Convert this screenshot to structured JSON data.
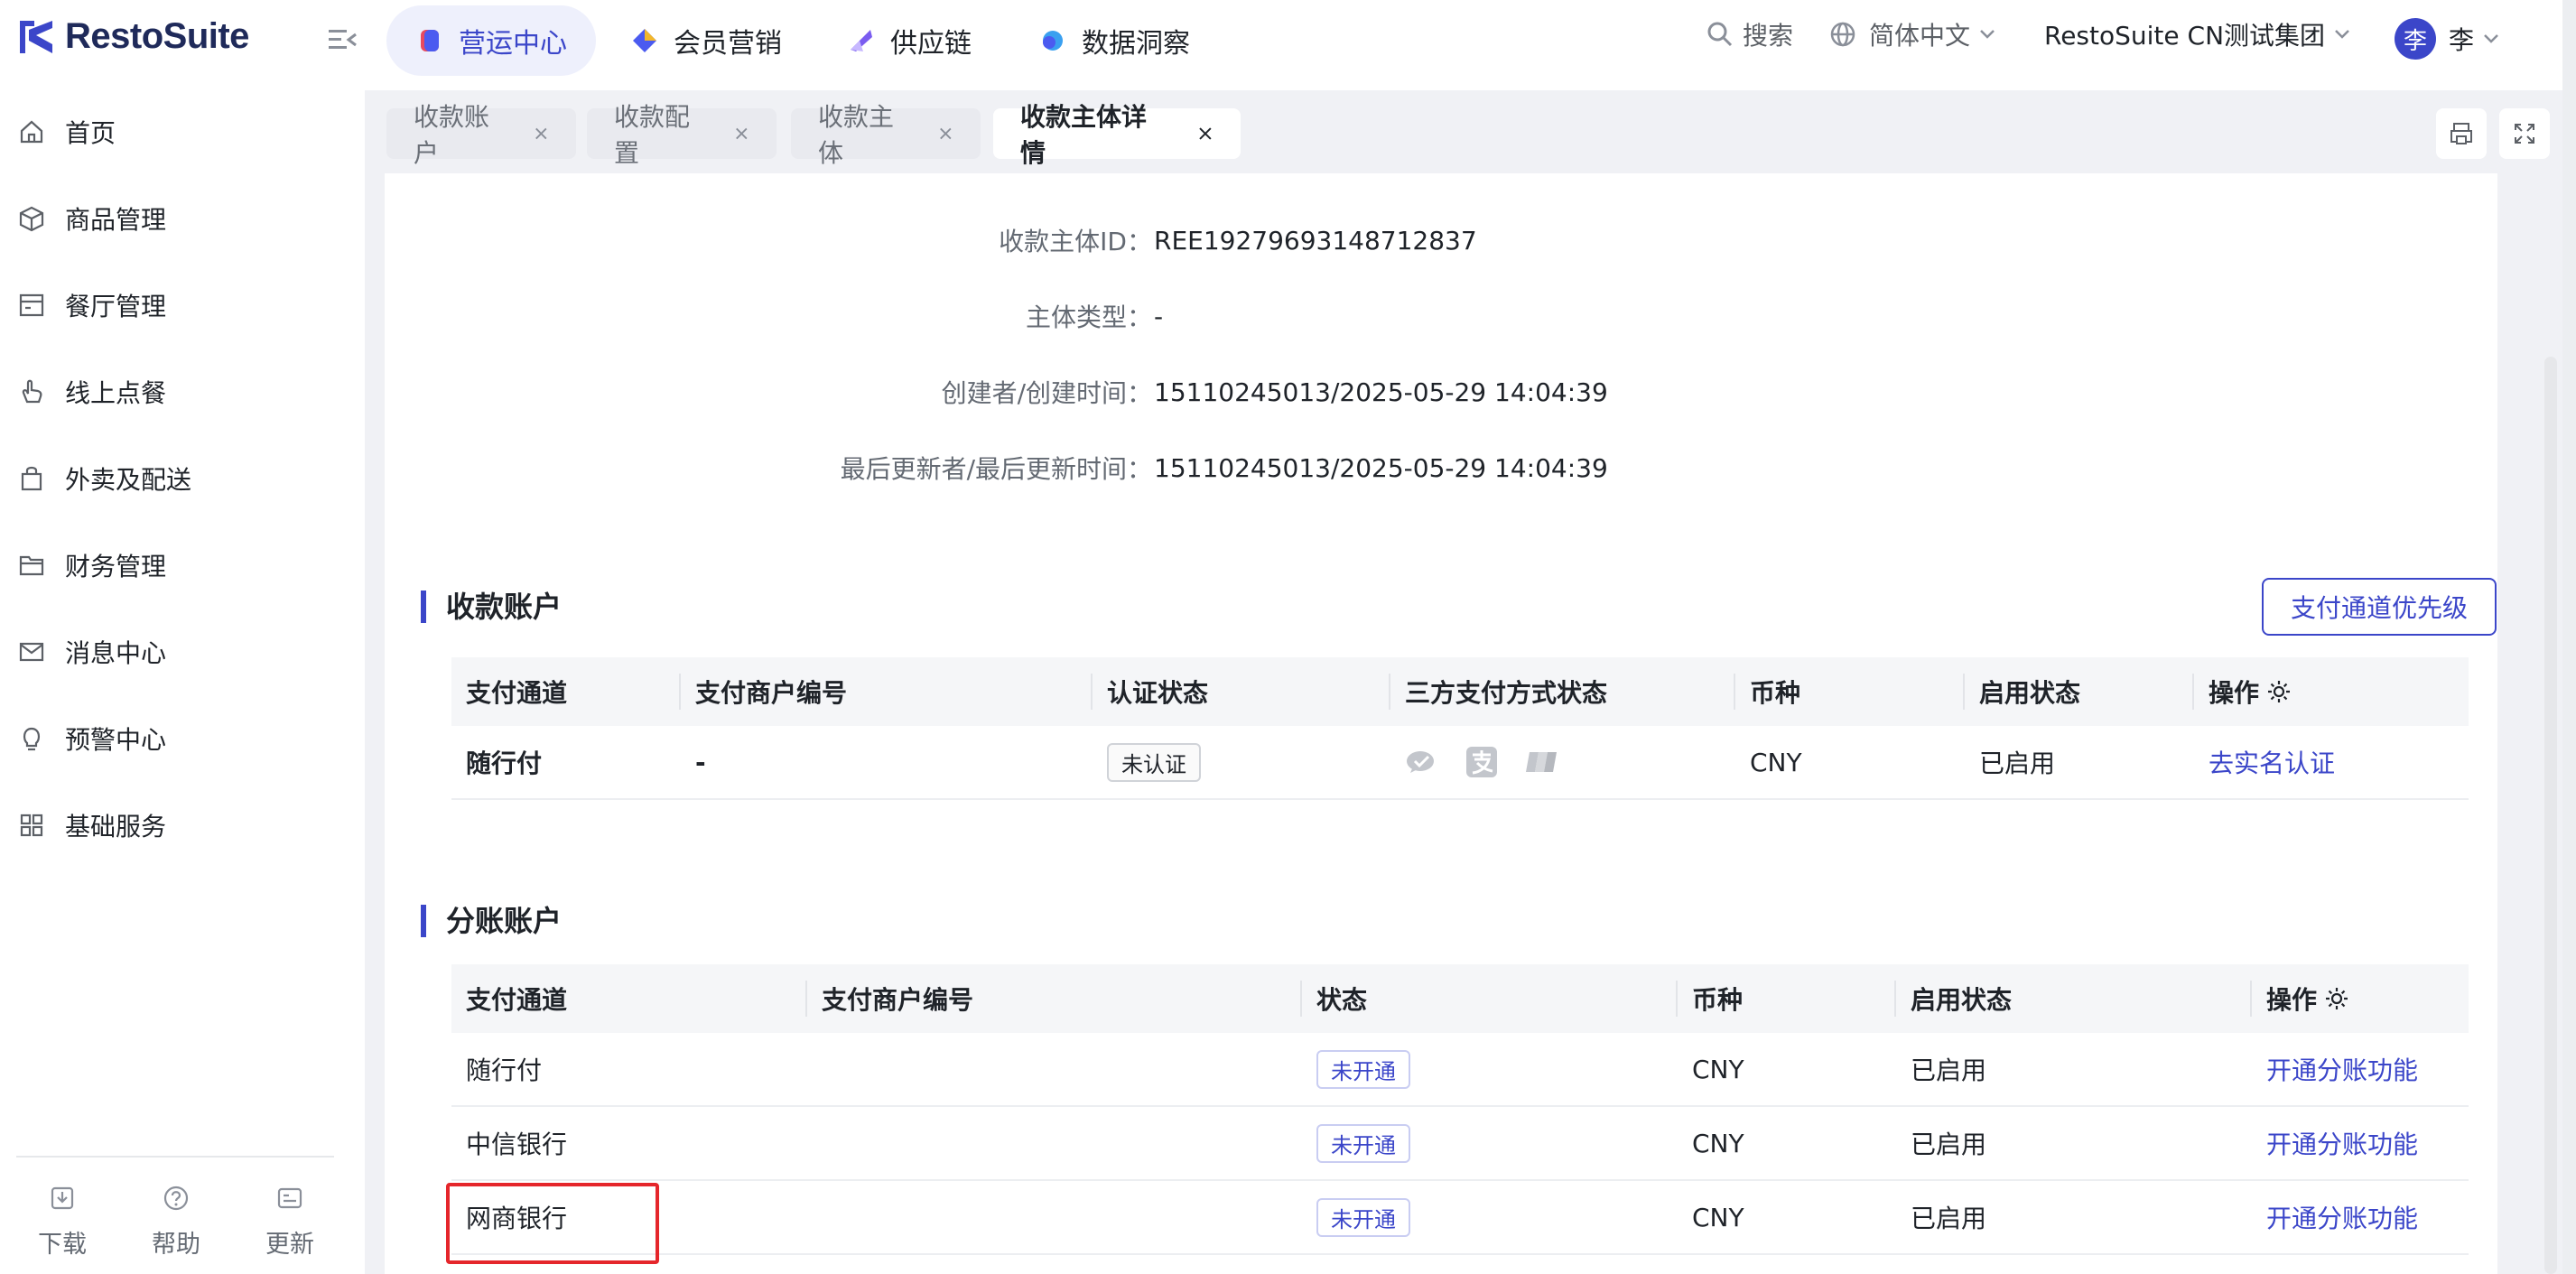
{
  "brand": {
    "name": "RestoSuite",
    "accent": "#3b46c9"
  },
  "topnav": {
    "items": [
      {
        "label": "营运中心",
        "active": true
      },
      {
        "label": "会员营销",
        "active": false
      },
      {
        "label": "供应链",
        "active": false
      },
      {
        "label": "数据洞察",
        "active": false
      }
    ],
    "search_label": "搜索",
    "language": "简体中文",
    "org": "RestoSuite CN测试集团",
    "avatar_char": "李",
    "user_name": "李"
  },
  "sidebar": {
    "items": [
      {
        "label": "首页",
        "icon": "home-icon"
      },
      {
        "label": "商品管理",
        "icon": "box-icon"
      },
      {
        "label": "餐厅管理",
        "icon": "store-icon"
      },
      {
        "label": "线上点餐",
        "icon": "hand-icon"
      },
      {
        "label": "外卖及配送",
        "icon": "bag-icon"
      },
      {
        "label": "财务管理",
        "icon": "folder-icon"
      },
      {
        "label": "消息中心",
        "icon": "mail-icon"
      },
      {
        "label": "预警中心",
        "icon": "bulb-icon"
      },
      {
        "label": "基础服务",
        "icon": "grid-icon"
      }
    ],
    "footer": [
      {
        "label": "下载",
        "icon": "download-icon"
      },
      {
        "label": "帮助",
        "icon": "help-icon"
      },
      {
        "label": "更新",
        "icon": "update-icon"
      }
    ]
  },
  "tabs": [
    {
      "label": "收款账户",
      "active": false
    },
    {
      "label": "收款配置",
      "active": false
    },
    {
      "label": "收款主体",
      "active": false
    },
    {
      "label": "收款主体详情",
      "active": true
    }
  ],
  "details": [
    {
      "label": "收款主体ID：",
      "value": "REE19279693148712837"
    },
    {
      "label": "主体类型：",
      "value": "-"
    },
    {
      "label": "创建者/创建时间：",
      "value": "15110245013/2025-05-29 14:04:39"
    },
    {
      "label": "最后更新者/最后更新时间：",
      "value": "15110245013/2025-05-29 14:04:39"
    }
  ],
  "receiving": {
    "title": "收款账户",
    "priority_button": "支付通道优先级",
    "headers": [
      "支付通道",
      "支付商户编号",
      "认证状态",
      "三方支付方式状态",
      "币种",
      "启用状态",
      "操作"
    ],
    "rows": [
      {
        "channel": "随行付",
        "merchant_no": "-",
        "auth": "未认证",
        "currency": "CNY",
        "enabled": "已启用",
        "action": "去实名认证"
      }
    ]
  },
  "split": {
    "title": "分账账户",
    "headers": [
      "支付通道",
      "支付商户编号",
      "状态",
      "币种",
      "启用状态",
      "操作"
    ],
    "rows": [
      {
        "channel": "随行付",
        "merchant_no": "",
        "status": "未开通",
        "currency": "CNY",
        "enabled": "已启用",
        "action": "开通分账功能"
      },
      {
        "channel": "中信银行",
        "merchant_no": "",
        "status": "未开通",
        "currency": "CNY",
        "enabled": "已启用",
        "action": "开通分账功能"
      },
      {
        "channel": "网商银行",
        "merchant_no": "",
        "status": "未开通",
        "currency": "CNY",
        "enabled": "已启用",
        "action": "开通分账功能"
      }
    ]
  }
}
